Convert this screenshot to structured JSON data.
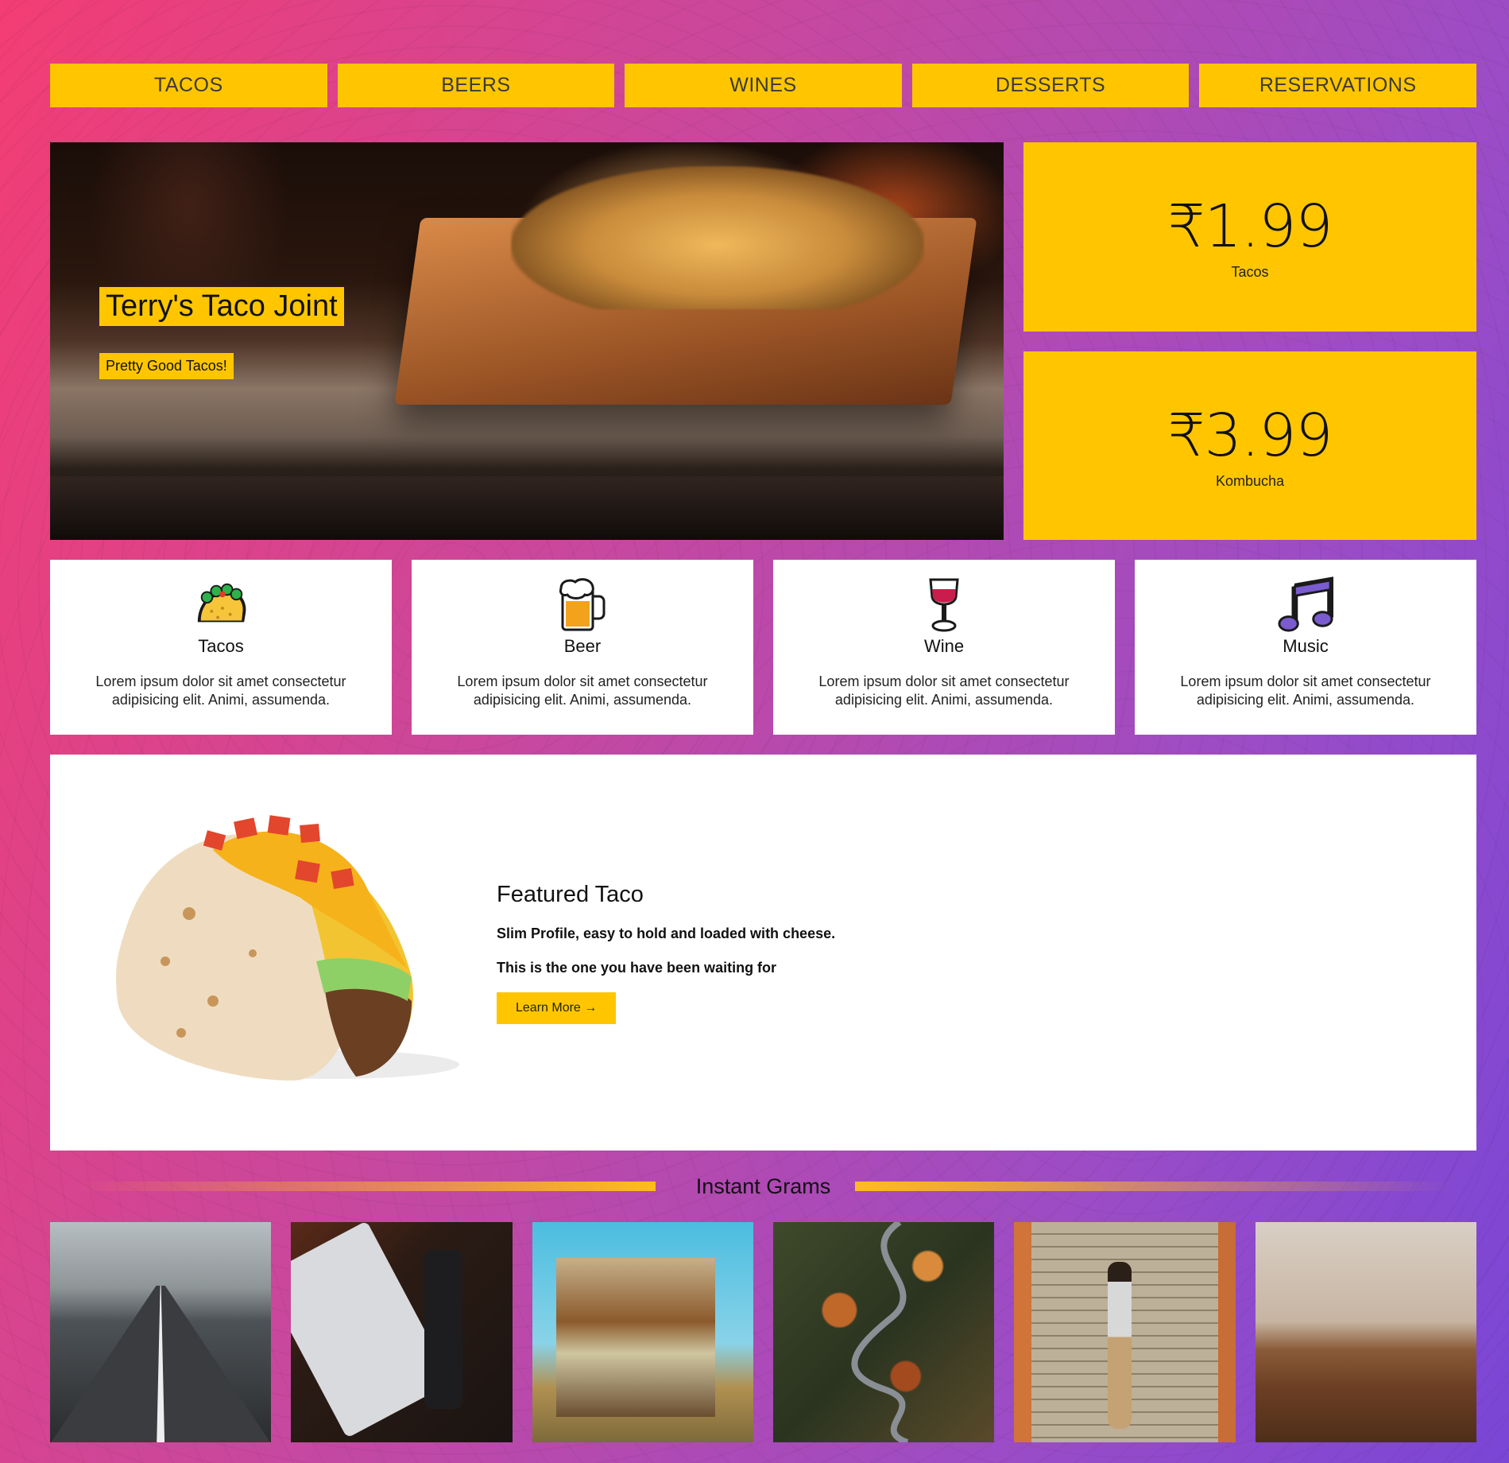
{
  "nav": {
    "items": [
      {
        "label": "TACOS"
      },
      {
        "label": "BEERS"
      },
      {
        "label": "WINES"
      },
      {
        "label": "DESSERTS"
      },
      {
        "label": "RESERVATIONS"
      }
    ]
  },
  "hero": {
    "title": "Terry's Taco Joint",
    "subtitle": "Pretty Good Tacos!"
  },
  "prices": [
    {
      "amount": "₹1.99",
      "label": "Tacos"
    },
    {
      "amount": "₹3.99",
      "label": "Kombucha"
    }
  ],
  "features": [
    {
      "icon": "taco-icon",
      "title": "Tacos",
      "text": "Lorem ipsum dolor sit amet consectetur adipisicing elit. Animi, assumenda."
    },
    {
      "icon": "beer-icon",
      "title": "Beer",
      "text": "Lorem ipsum dolor sit amet consectetur adipisicing elit. Animi, assumenda."
    },
    {
      "icon": "wine-icon",
      "title": "Wine",
      "text": "Lorem ipsum dolor sit amet consectetur adipisicing elit. Animi, assumenda."
    },
    {
      "icon": "music-note-icon",
      "title": "Music",
      "text": "Lorem ipsum dolor sit amet consectetur adipisicing elit. Animi, assumenda."
    }
  ],
  "featured": {
    "title": "Featured Taco",
    "line1": "Slim Profile, easy to hold and loaded with cheese.",
    "line2": "This is the one you have been waiting for",
    "button": "Learn More →"
  },
  "grams": {
    "title": "Instant Grams",
    "image_count": 6
  },
  "colors": {
    "accent": "#ffc600",
    "gradient_start": "#f33d74",
    "gradient_end": "#7a46d6",
    "card_bg": "#ffffff"
  }
}
